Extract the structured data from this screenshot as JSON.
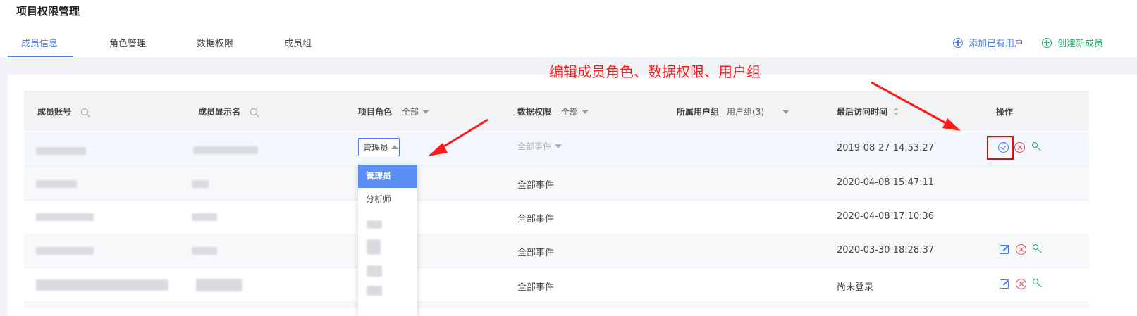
{
  "header": {
    "title": "项目权限管理",
    "tabs": [
      {
        "label": "成员信息"
      },
      {
        "label": "角色管理"
      },
      {
        "label": "数据权限"
      },
      {
        "label": "成员组"
      }
    ],
    "active_tab": "成员信息",
    "actions": {
      "add_existing": "添加已有用户",
      "create_new": "创建新成员"
    }
  },
  "annotation": {
    "text": "编辑成员角色、数据权限、用户组"
  },
  "table": {
    "columns": {
      "account": "成员账号",
      "display_name": "成员显示名",
      "role": "项目角色",
      "role_filter": "全部",
      "data_permission": "数据权限",
      "data_filter": "全部",
      "user_group": "所属用户组",
      "user_group_filter": "用户组(3)",
      "last_visit": "最后访问时间",
      "operations": "操作"
    },
    "rows": [
      {
        "role": "管理员",
        "data_permission": "全部事件",
        "last_visit": "2019-08-27 14:53:27"
      },
      {
        "role": "",
        "data_permission": "全部事件",
        "last_visit": "2020-04-08 15:47:11"
      },
      {
        "role": "",
        "data_permission": "全部事件",
        "last_visit": "2020-04-08 17:10:36"
      },
      {
        "role": "",
        "data_permission": "全部事件",
        "last_visit": "2020-03-30 18:28:37"
      },
      {
        "role": "",
        "data_permission": "全部事件",
        "last_visit": "尚未登录"
      }
    ]
  },
  "role_dropdown": {
    "options": [
      "管理员",
      "分析师"
    ],
    "selected": "管理员"
  },
  "colors": {
    "accent": "#4d7cf0",
    "danger": "#e5454f",
    "success": "#2aa86b",
    "annotation": "#ff1a1a"
  },
  "icons": [
    "search-icon",
    "plus-circle-icon",
    "check-circle-icon",
    "close-circle-icon",
    "key-icon",
    "edit-icon",
    "sort-icon",
    "chevron-down-icon",
    "chevron-up-icon"
  ]
}
